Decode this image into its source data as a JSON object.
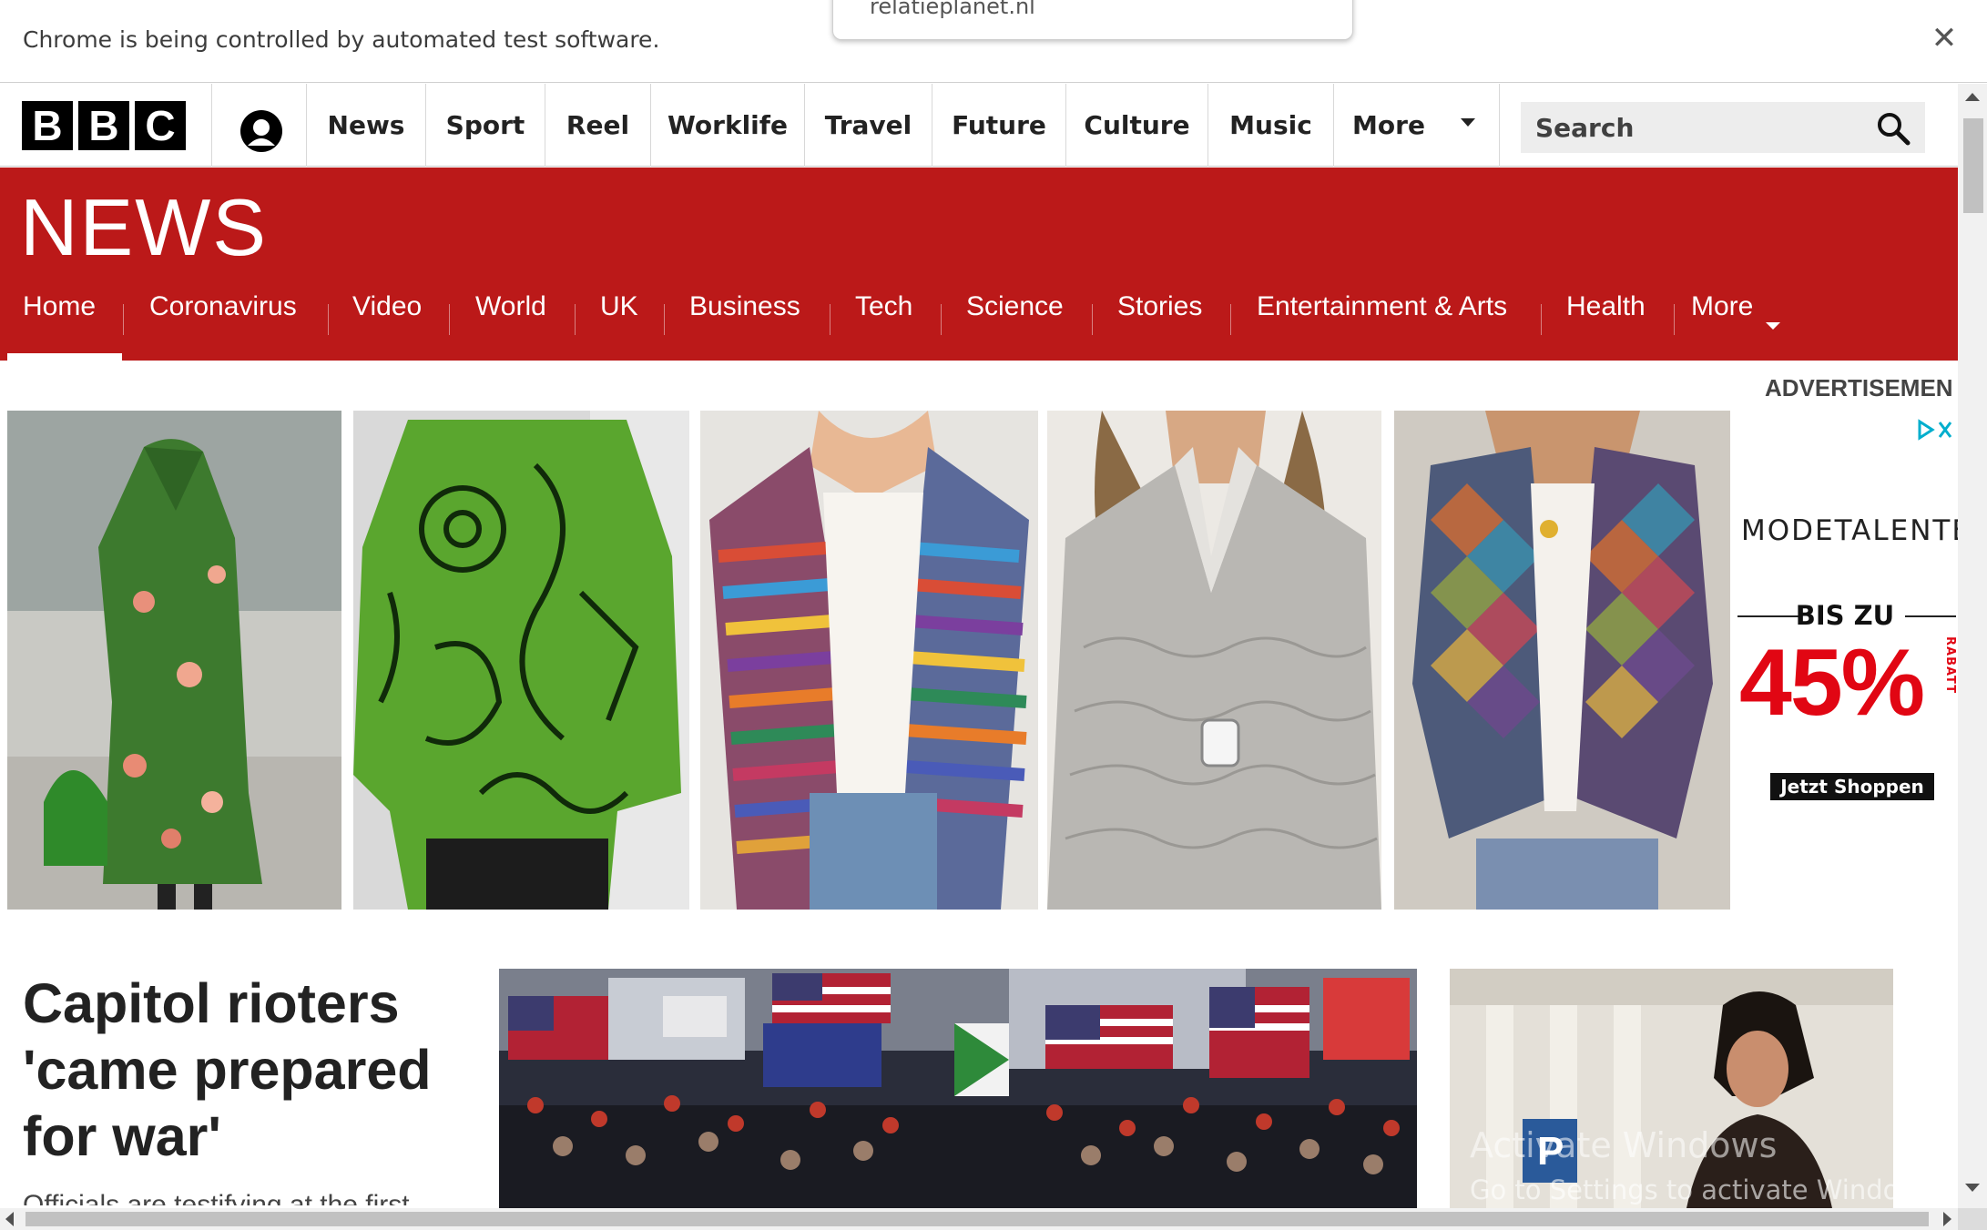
{
  "browser": {
    "infobar_message": "Chrome is being controlled by automated test software.",
    "popup_text": "relatieplanet.nl",
    "close_symbol": "✕"
  },
  "global_nav": {
    "logo_letters": [
      "B",
      "B",
      "C"
    ],
    "account_icon": "account-icon",
    "items": [
      "News",
      "Sport",
      "Reel",
      "Worklife",
      "Travel",
      "Future",
      "Culture",
      "Music",
      "More"
    ],
    "search_placeholder": "Search",
    "search_icon": "search-icon"
  },
  "news_header": {
    "wordmark": "NEWS",
    "nav_items": [
      "Home",
      "Coronavirus",
      "Video",
      "World",
      "UK",
      "Business",
      "Tech",
      "Science",
      "Stories",
      "Entertainment & Arts",
      "Health",
      "More"
    ],
    "active_item": "Home",
    "colors": {
      "brand_red": "#bb1919",
      "text": "#ffffff"
    }
  },
  "advertisement": {
    "label": "ADVERTISEMEN",
    "products": [
      "green-floral-coat",
      "green-geometric-sweater",
      "striped-cardigan",
      "grey-lace-sweater",
      "patchwork-cardigan"
    ],
    "brand": "MODETALENTE",
    "offer_prefix": "BIS ZU",
    "discount": "45%",
    "discount_suffix": "RABATT",
    "cta": "Jetzt Shoppen",
    "adchoices_icon": "adchoices-icon"
  },
  "top_story": {
    "headline": "Capitol rioters 'came prepared for war'",
    "summary": "Officials are testifying at the first",
    "image": "capitol-rally-crowd-with-flags"
  },
  "secondary_story": {
    "image": "woman-portrait-in-front-of-building"
  },
  "os_watermark": {
    "line1": "Activate Windows",
    "line2": "Go to Settings to activate Windows."
  }
}
